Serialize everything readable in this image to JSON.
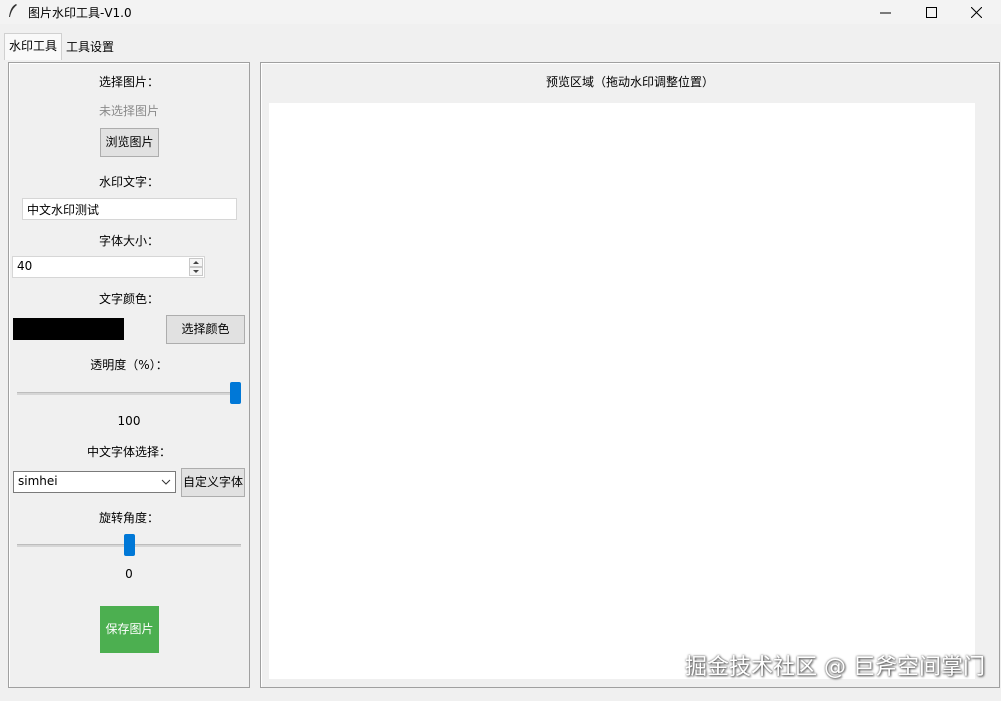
{
  "window": {
    "title": "图片水印工具-V1.0",
    "minimize_glyph": "—",
    "maximize_glyph": "☐",
    "close_glyph": "✕"
  },
  "tabs": [
    {
      "label": "水印工具",
      "active": true
    },
    {
      "label": "工具设置",
      "active": false
    }
  ],
  "left": {
    "select_image_label": "选择图片：",
    "no_image_text": "未选择图片",
    "browse_button": "浏览图片",
    "watermark_text_label": "水印文字：",
    "watermark_text_value": "中文水印测试",
    "font_size_label": "字体大小：",
    "font_size_value": "40",
    "text_color_label": "文字颜色：",
    "text_color": "#000000",
    "choose_color_button": "选择颜色",
    "opacity_label": "透明度（%）：",
    "opacity_value": "100",
    "opacity_fraction": 1.0,
    "font_select_label": "中文字体选择：",
    "font_select_value": "simhei",
    "custom_font_button": "自定义字体",
    "rotation_label": "旋转角度：",
    "rotation_value": "0",
    "rotation_fraction": 0.5,
    "save_button": "保存图片",
    "save_button_color": "#4caf50"
  },
  "right": {
    "preview_title": "预览区域（拖动水印调整位置）"
  },
  "overlay": {
    "watermark_text": "掘金技术社区 @ 巨斧空间掌门"
  }
}
